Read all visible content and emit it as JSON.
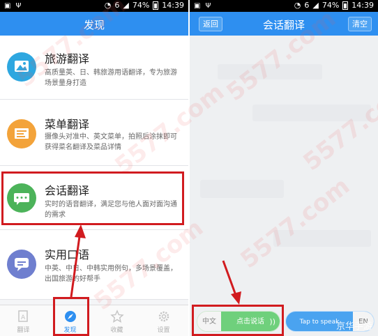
{
  "left_screen": {
    "status": {
      "battery": "74%",
      "time": "14:39",
      "signal": "6"
    },
    "header": {
      "title": "发现"
    },
    "features": [
      {
        "title": "旅游翻译",
        "desc": "高质量英、日、韩旅游用语翻译，专为旅游场景量身打造"
      },
      {
        "title": "菜单翻译",
        "desc": "摄像头对准中、英文菜单，拍照后涂抹即可获得菜名翻译及菜品详情"
      },
      {
        "title": "会话翻译",
        "desc": "实时的语音翻译，满足您与他人面对面沟通的需求"
      },
      {
        "title": "实用口语",
        "desc": "中英、中日、中韩实用例句，多场景覆盖，出国旅游的好帮手"
      }
    ],
    "tabs": [
      {
        "label": "翻译",
        "icon": "translate-icon"
      },
      {
        "label": "发现",
        "icon": "discover-icon"
      },
      {
        "label": "收藏",
        "icon": "star-icon"
      },
      {
        "label": "设置",
        "icon": "gear-icon"
      }
    ]
  },
  "right_screen": {
    "status": {
      "battery": "74%",
      "time": "14:39",
      "signal": "6"
    },
    "header": {
      "title": "会话翻译",
      "back_label": "返回",
      "clear_label": "清空"
    },
    "bottom": {
      "chinese_code": "中文",
      "chinese_talk": "点击说话",
      "english_talk": "Tap to speak",
      "english_code": "EN"
    }
  },
  "watermark": "5577.com",
  "corner_mark": "京华手游",
  "colors": {
    "accent": "#2e8ff0",
    "highlight": "#d11b1f",
    "talk_green": "#6fd07c"
  }
}
